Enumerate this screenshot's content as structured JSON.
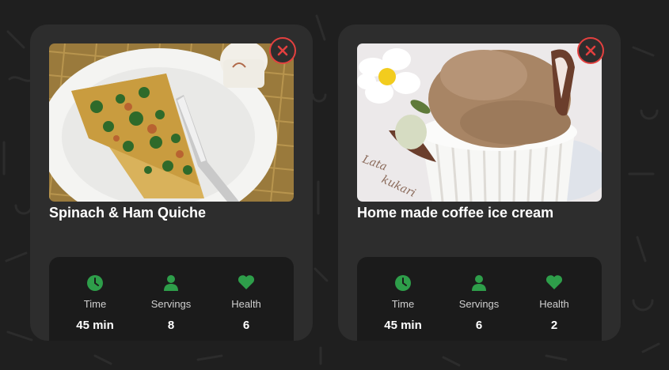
{
  "cards": [
    {
      "title": "Spinach & Ham Quiche",
      "stats": [
        {
          "label": "Time",
          "value": "45 min",
          "icon": "clock-icon"
        },
        {
          "label": "Servings",
          "value": "8",
          "icon": "person-icon"
        },
        {
          "label": "Health",
          "value": "6",
          "icon": "heart-icon"
        }
      ]
    },
    {
      "title": "Home made coffee ice cream",
      "stats": [
        {
          "label": "Time",
          "value": "45 min",
          "icon": "clock-icon"
        },
        {
          "label": "Servings",
          "value": "6",
          "icon": "person-icon"
        },
        {
          "label": "Health",
          "value": "2",
          "icon": "heart-icon"
        }
      ]
    }
  ],
  "colors": {
    "accent_green": "#2e9e4a",
    "close_red": "#e3403f",
    "card_bg": "#2d2d2d",
    "stats_bg": "#1b1b1b"
  }
}
